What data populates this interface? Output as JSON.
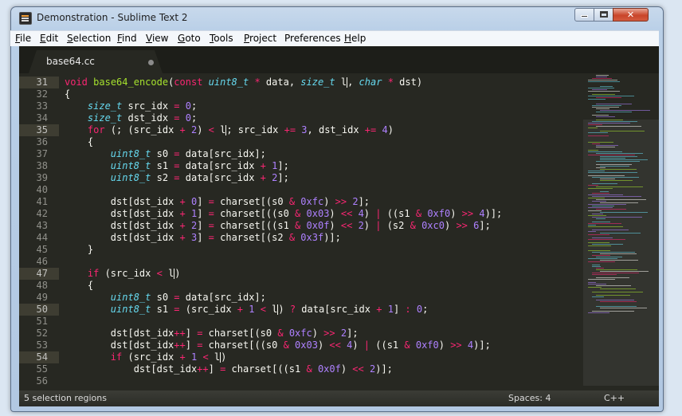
{
  "window": {
    "title": "Demonstration - Sublime Text 2",
    "min_glyph": "",
    "max_glyph": "",
    "close_glyph": "✕"
  },
  "menu": [
    {
      "u": "F",
      "rest": "ile"
    },
    {
      "u": "E",
      "rest": "dit"
    },
    {
      "u": "S",
      "rest": "election"
    },
    {
      "u": "F",
      "rest": "ind",
      "pre": ""
    },
    {
      "u": "V",
      "rest": "iew"
    },
    {
      "u": "G",
      "rest": "oto"
    },
    {
      "u": "T",
      "rest": "ools"
    },
    {
      "u": "P",
      "rest": "roject"
    },
    {
      "u": "",
      "rest": "Preferences",
      "preU": "n"
    },
    {
      "u": "H",
      "rest": "elp"
    }
  ],
  "menu_text": [
    "File",
    "Edit",
    "Selection",
    "Find",
    "View",
    "Goto",
    "Tools",
    "Project",
    "Preferences",
    "Help"
  ],
  "tab": {
    "label": "base64.cc",
    "modified_icon": "dot-icon"
  },
  "gutter": {
    "start": 31,
    "selected_lines": [
      31,
      35,
      47,
      50,
      54
    ]
  },
  "code_lines": [
    [
      [
        "k",
        "void"
      ],
      [
        "p",
        " "
      ],
      [
        "f",
        "base64_encode"
      ],
      [
        "p",
        "("
      ],
      [
        "k",
        "const"
      ],
      [
        "p",
        " "
      ],
      [
        "t",
        "uint8_t"
      ],
      [
        "p",
        " "
      ],
      [
        "k",
        "*"
      ],
      [
        "p",
        " data, "
      ],
      [
        "t",
        "size_t"
      ],
      [
        "p",
        " l"
      ],
      [
        "c",
        ""
      ],
      [
        "p",
        ", "
      ],
      [
        "t",
        "char"
      ],
      [
        "p",
        " "
      ],
      [
        "k",
        "*"
      ],
      [
        "p",
        " dst)"
      ]
    ],
    [
      [
        "p",
        "{"
      ]
    ],
    [
      [
        "p",
        "    "
      ],
      [
        "t",
        "size_t"
      ],
      [
        "p",
        " src_idx "
      ],
      [
        "k",
        "="
      ],
      [
        "p",
        " "
      ],
      [
        "n",
        "0"
      ],
      [
        "p",
        ";"
      ]
    ],
    [
      [
        "p",
        "    "
      ],
      [
        "t",
        "size_t"
      ],
      [
        "p",
        " dst_idx "
      ],
      [
        "k",
        "="
      ],
      [
        "p",
        " "
      ],
      [
        "n",
        "0"
      ],
      [
        "p",
        ";"
      ]
    ],
    [
      [
        "p",
        "    "
      ],
      [
        "k",
        "for"
      ],
      [
        "p",
        " (; (src_idx "
      ],
      [
        "k",
        "+"
      ],
      [
        "p",
        " "
      ],
      [
        "n",
        "2"
      ],
      [
        "p",
        ") "
      ],
      [
        "k",
        "<"
      ],
      [
        "p",
        " l"
      ],
      [
        "c",
        ""
      ],
      [
        "p",
        "; src_idx "
      ],
      [
        "k",
        "+="
      ],
      [
        "p",
        " "
      ],
      [
        "n",
        "3"
      ],
      [
        "p",
        ", dst_idx "
      ],
      [
        "k",
        "+="
      ],
      [
        "p",
        " "
      ],
      [
        "n",
        "4"
      ],
      [
        "p",
        ")"
      ]
    ],
    [
      [
        "p",
        "    {"
      ]
    ],
    [
      [
        "p",
        "        "
      ],
      [
        "t",
        "uint8_t"
      ],
      [
        "p",
        " s0 "
      ],
      [
        "k",
        "="
      ],
      [
        "p",
        " data[src_idx];"
      ]
    ],
    [
      [
        "p",
        "        "
      ],
      [
        "t",
        "uint8_t"
      ],
      [
        "p",
        " s1 "
      ],
      [
        "k",
        "="
      ],
      [
        "p",
        " data[src_idx "
      ],
      [
        "k",
        "+"
      ],
      [
        "p",
        " "
      ],
      [
        "n",
        "1"
      ],
      [
        "p",
        "];"
      ]
    ],
    [
      [
        "p",
        "        "
      ],
      [
        "t",
        "uint8_t"
      ],
      [
        "p",
        " s2 "
      ],
      [
        "k",
        "="
      ],
      [
        "p",
        " data[src_idx "
      ],
      [
        "k",
        "+"
      ],
      [
        "p",
        " "
      ],
      [
        "n",
        "2"
      ],
      [
        "p",
        "];"
      ]
    ],
    [],
    [
      [
        "p",
        "        dst[dst_idx "
      ],
      [
        "k",
        "+"
      ],
      [
        "p",
        " "
      ],
      [
        "n",
        "0"
      ],
      [
        "p",
        "] "
      ],
      [
        "k",
        "="
      ],
      [
        "p",
        " charset[(s0 "
      ],
      [
        "k",
        "&"
      ],
      [
        "p",
        " "
      ],
      [
        "n",
        "0xfc"
      ],
      [
        "p",
        ") "
      ],
      [
        "k",
        ">>"
      ],
      [
        "p",
        " "
      ],
      [
        "n",
        "2"
      ],
      [
        "p",
        "];"
      ]
    ],
    [
      [
        "p",
        "        dst[dst_idx "
      ],
      [
        "k",
        "+"
      ],
      [
        "p",
        " "
      ],
      [
        "n",
        "1"
      ],
      [
        "p",
        "] "
      ],
      [
        "k",
        "="
      ],
      [
        "p",
        " charset[((s0 "
      ],
      [
        "k",
        "&"
      ],
      [
        "p",
        " "
      ],
      [
        "n",
        "0x03"
      ],
      [
        "p",
        ") "
      ],
      [
        "k",
        "<<"
      ],
      [
        "p",
        " "
      ],
      [
        "n",
        "4"
      ],
      [
        "p",
        ") "
      ],
      [
        "k",
        "|"
      ],
      [
        "p",
        " ((s1 "
      ],
      [
        "k",
        "&"
      ],
      [
        "p",
        " "
      ],
      [
        "n",
        "0xf0"
      ],
      [
        "p",
        ") "
      ],
      [
        "k",
        ">>"
      ],
      [
        "p",
        " "
      ],
      [
        "n",
        "4"
      ],
      [
        "p",
        ")];"
      ]
    ],
    [
      [
        "p",
        "        dst[dst_idx "
      ],
      [
        "k",
        "+"
      ],
      [
        "p",
        " "
      ],
      [
        "n",
        "2"
      ],
      [
        "p",
        "] "
      ],
      [
        "k",
        "="
      ],
      [
        "p",
        " charset[((s1 "
      ],
      [
        "k",
        "&"
      ],
      [
        "p",
        " "
      ],
      [
        "n",
        "0x0f"
      ],
      [
        "p",
        ") "
      ],
      [
        "k",
        "<<"
      ],
      [
        "p",
        " "
      ],
      [
        "n",
        "2"
      ],
      [
        "p",
        ") "
      ],
      [
        "k",
        "|"
      ],
      [
        "p",
        " (s2 "
      ],
      [
        "k",
        "&"
      ],
      [
        "p",
        " "
      ],
      [
        "n",
        "0xc0"
      ],
      [
        "p",
        ") "
      ],
      [
        "k",
        ">>"
      ],
      [
        "p",
        " "
      ],
      [
        "n",
        "6"
      ],
      [
        "p",
        "];"
      ]
    ],
    [
      [
        "p",
        "        dst[dst_idx "
      ],
      [
        "k",
        "+"
      ],
      [
        "p",
        " "
      ],
      [
        "n",
        "3"
      ],
      [
        "p",
        "] "
      ],
      [
        "k",
        "="
      ],
      [
        "p",
        " charset[(s2 "
      ],
      [
        "k",
        "&"
      ],
      [
        "p",
        " "
      ],
      [
        "n",
        "0x3f"
      ],
      [
        "p",
        ")];"
      ]
    ],
    [
      [
        "p",
        "    }"
      ]
    ],
    [],
    [
      [
        "p",
        "    "
      ],
      [
        "k",
        "if"
      ],
      [
        "p",
        " (src_idx "
      ],
      [
        "k",
        "<"
      ],
      [
        "p",
        " l"
      ],
      [
        "c",
        ""
      ],
      [
        "p",
        ")"
      ]
    ],
    [
      [
        "p",
        "    {"
      ]
    ],
    [
      [
        "p",
        "        "
      ],
      [
        "t",
        "uint8_t"
      ],
      [
        "p",
        " s0 "
      ],
      [
        "k",
        "="
      ],
      [
        "p",
        " data[src_idx];"
      ]
    ],
    [
      [
        "p",
        "        "
      ],
      [
        "t",
        "uint8_t"
      ],
      [
        "p",
        " s1 "
      ],
      [
        "k",
        "="
      ],
      [
        "p",
        " (src_idx "
      ],
      [
        "k",
        "+"
      ],
      [
        "p",
        " "
      ],
      [
        "n",
        "1"
      ],
      [
        "p",
        " "
      ],
      [
        "k",
        "<"
      ],
      [
        "p",
        " l"
      ],
      [
        "c",
        ""
      ],
      [
        "p",
        ") "
      ],
      [
        "k",
        "?"
      ],
      [
        "p",
        " data[src_idx "
      ],
      [
        "k",
        "+"
      ],
      [
        "p",
        " "
      ],
      [
        "n",
        "1"
      ],
      [
        "p",
        "] "
      ],
      [
        "k",
        ":"
      ],
      [
        "p",
        " "
      ],
      [
        "n",
        "0"
      ],
      [
        "p",
        ";"
      ]
    ],
    [],
    [
      [
        "p",
        "        dst[dst_idx"
      ],
      [
        "k",
        "++"
      ],
      [
        "p",
        "] "
      ],
      [
        "k",
        "="
      ],
      [
        "p",
        " charset[(s0 "
      ],
      [
        "k",
        "&"
      ],
      [
        "p",
        " "
      ],
      [
        "n",
        "0xfc"
      ],
      [
        "p",
        ") "
      ],
      [
        "k",
        ">>"
      ],
      [
        "p",
        " "
      ],
      [
        "n",
        "2"
      ],
      [
        "p",
        "];"
      ]
    ],
    [
      [
        "p",
        "        dst[dst_idx"
      ],
      [
        "k",
        "++"
      ],
      [
        "p",
        "] "
      ],
      [
        "k",
        "="
      ],
      [
        "p",
        " charset[((s0 "
      ],
      [
        "k",
        "&"
      ],
      [
        "p",
        " "
      ],
      [
        "n",
        "0x03"
      ],
      [
        "p",
        ") "
      ],
      [
        "k",
        "<<"
      ],
      [
        "p",
        " "
      ],
      [
        "n",
        "4"
      ],
      [
        "p",
        ") "
      ],
      [
        "k",
        "|"
      ],
      [
        "p",
        " ((s1 "
      ],
      [
        "k",
        "&"
      ],
      [
        "p",
        " "
      ],
      [
        "n",
        "0xf0"
      ],
      [
        "p",
        ") "
      ],
      [
        "k",
        ">>"
      ],
      [
        "p",
        " "
      ],
      [
        "n",
        "4"
      ],
      [
        "p",
        ")];"
      ]
    ],
    [
      [
        "p",
        "        "
      ],
      [
        "k",
        "if"
      ],
      [
        "p",
        " (src_idx "
      ],
      [
        "k",
        "+"
      ],
      [
        "p",
        " "
      ],
      [
        "n",
        "1"
      ],
      [
        "p",
        " "
      ],
      [
        "k",
        "<"
      ],
      [
        "p",
        " l"
      ],
      [
        "c",
        ""
      ],
      [
        "p",
        ")"
      ]
    ],
    [
      [
        "p",
        "            dst[dst_idx"
      ],
      [
        "k",
        "++"
      ],
      [
        "p",
        "] "
      ],
      [
        "k",
        "="
      ],
      [
        "p",
        " charset[((s1 "
      ],
      [
        "k",
        "&"
      ],
      [
        "p",
        " "
      ],
      [
        "n",
        "0x0f"
      ],
      [
        "p",
        ") "
      ],
      [
        "k",
        "<<"
      ],
      [
        "p",
        " "
      ],
      [
        "n",
        "2"
      ],
      [
        "p",
        ")];"
      ]
    ],
    [
      [
        "p",
        "        "
      ]
    ]
  ],
  "status": {
    "left": "5 selection regions",
    "spaces": "Spaces: 4",
    "syntax": "C++"
  },
  "colors": {
    "background": "#272822",
    "keyword": "#f92672",
    "type": "#66d9ef",
    "function": "#a6e22e",
    "number": "#ae81ff",
    "text": "#f8f8f2"
  }
}
